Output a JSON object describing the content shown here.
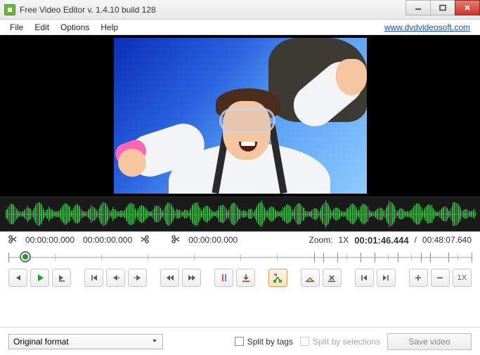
{
  "titlebar": {
    "title": "Free Video Editor v. 1.4.10 build 128"
  },
  "menu": {
    "file": "File",
    "edit": "Edit",
    "options": "Options",
    "help": "Help",
    "site_link": "www.dvdvideosoft.com"
  },
  "markers": {
    "sel_start": "00:00:00.000",
    "sel_end": "00:00:00.000",
    "cursor": "00:00:00.000"
  },
  "zoom": {
    "label": "Zoom:",
    "value": "1X"
  },
  "time": {
    "current": "00:01:46.444",
    "sep": "/",
    "total": "00:48:07.640"
  },
  "buttons": {
    "zoom_current": "1X"
  },
  "bottom": {
    "format": "Original format",
    "split_tags": "Split by tags",
    "split_selections": "Split by selections",
    "save": "Save video"
  },
  "ruler": {
    "major_ticks_pct": [
      0,
      4,
      66,
      68,
      71,
      76,
      79,
      84,
      89,
      91,
      95,
      100
    ],
    "minor_ticks_pct": [
      10,
      20,
      30,
      40,
      50,
      58,
      73,
      82,
      87,
      97
    ],
    "playhead_pct": 3.7
  }
}
